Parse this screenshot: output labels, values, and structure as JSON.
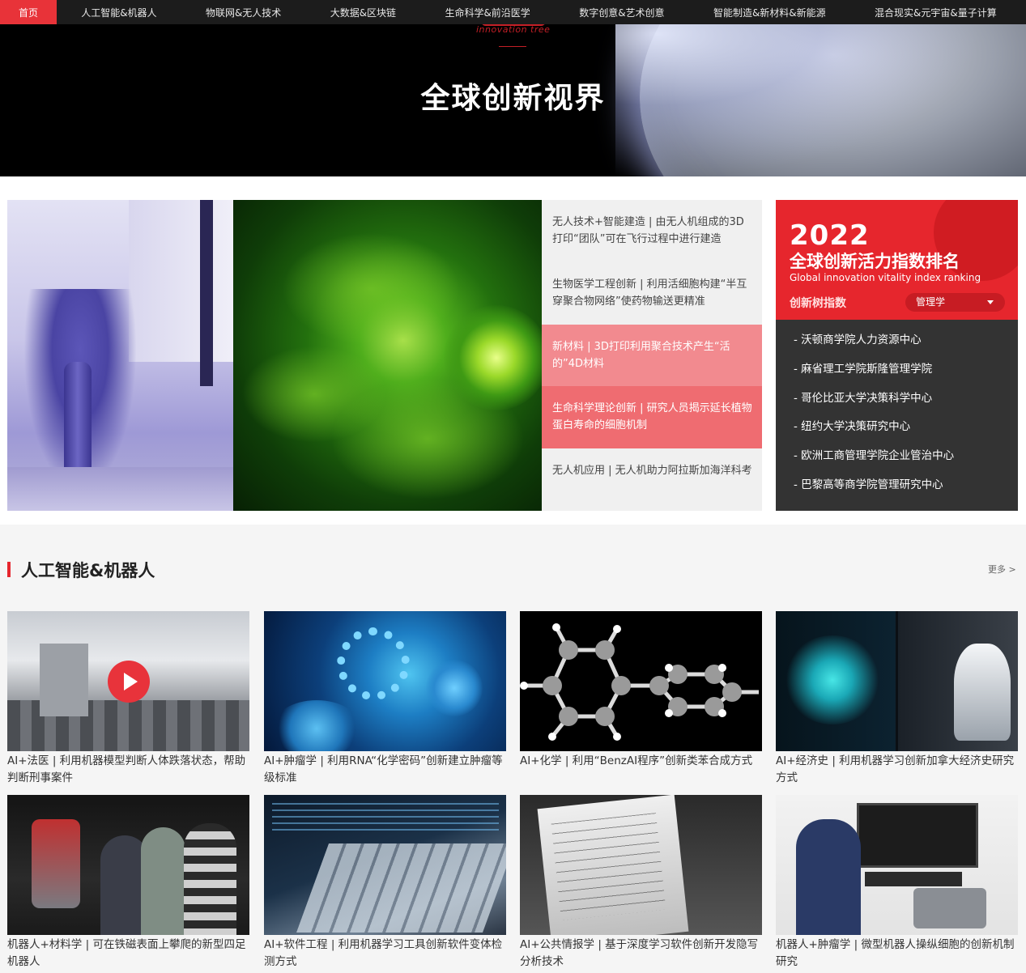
{
  "nav": {
    "home": "首页",
    "items": [
      "人工智能&机器人",
      "物联网&无人技术",
      "大数据&区块链",
      "生命科学&前沿医学",
      "数字创意&艺术创意",
      "智能制造&新材料&新能源",
      "混合现实&元宇宙&量子计算"
    ]
  },
  "hero": {
    "logo_text": "innovation tree",
    "title": "全球创新视界"
  },
  "featured_news": [
    "无人技术+智能建造 | 由无人机组成的3D打印“团队”可在飞行过程中进行建造",
    "生物医学工程创新 | 利用活细胞构建“半互穿聚合物网络”使药物输送更精准",
    "新材料 | 3D打印利用聚合技术产生“活的”4D材料",
    "生命科学理论创新 | 研究人员揭示延长植物蛋白寿命的细胞机制",
    "无人机应用 | 无人机助力阿拉斯加海洋科考"
  ],
  "ranking": {
    "year": "2022",
    "title": "全球创新活力指数排名",
    "subtitle": "Global innovation vitality index ranking",
    "label": "创新树指数",
    "select": "管理学",
    "items": [
      "- 沃顿商学院人力资源中心",
      "- 麻省理工学院斯隆管理学院",
      "- 哥伦比亚大学决策科学中心",
      "- 纽约大学决策研究中心",
      "- 欧洲工商管理学院企业管治中心",
      "- 巴黎高等商学院管理研究中心"
    ]
  },
  "section": {
    "title": "人工智能&机器人",
    "more": "更多 >"
  },
  "cards": [
    "AI+法医 | 利用机器模型判断人体跌落状态，帮助判断刑事案件",
    "AI+肿瘤学 | 利用RNA“化学密码”创新建立肿瘤等级标准",
    "AI+化学 | 利用“BenzAI程序”创新类苯合成方式",
    "AI+经济史 | 利用机器学习创新加拿大经济史研究方式",
    "机器人+材料学 | 可在铁磁表面上攀爬的新型四足机器人",
    "AI+软件工程 | 利用机器学习工具创新软件变体检测方式",
    "AI+公共情报学 | 基于深度学习软件创新开发隐写分析技术",
    "机器人+肿瘤学 | 微型机器人操纵细胞的创新机制研究"
  ],
  "colors": {
    "accent": "#e6262d",
    "nav_bg": "#1c1c1c",
    "ranking_bg": "#333333"
  }
}
